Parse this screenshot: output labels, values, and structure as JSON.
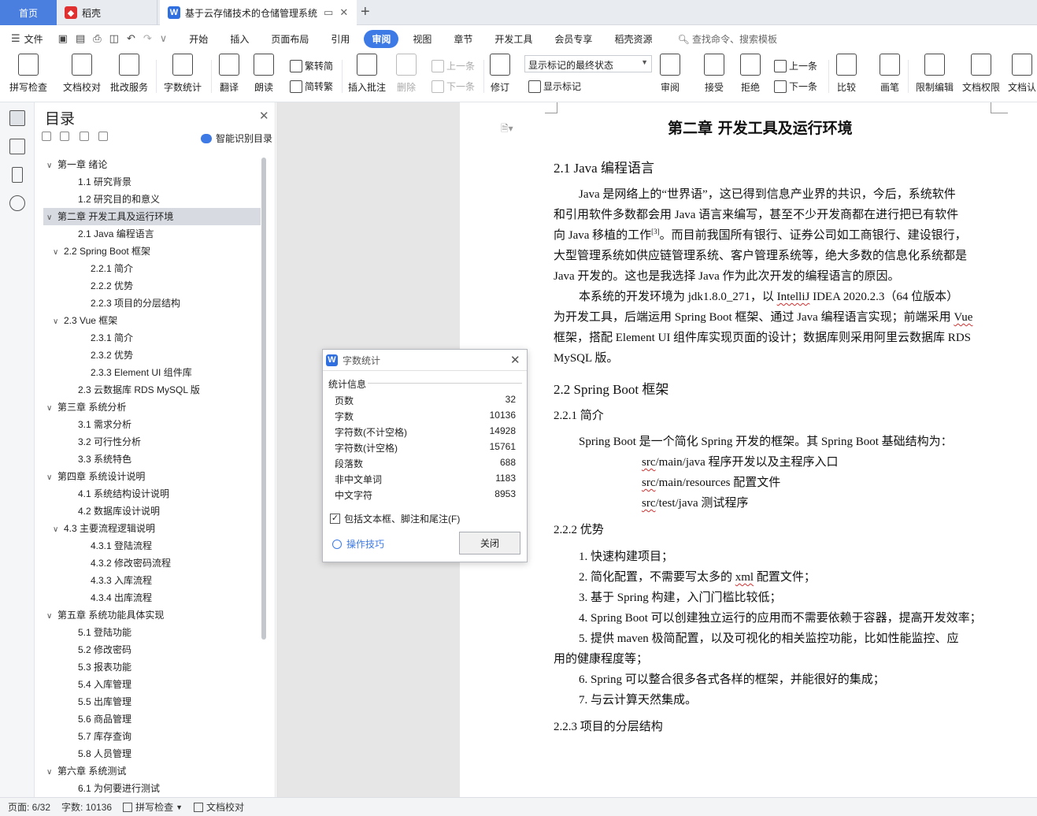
{
  "titlebar": {
    "home_tab": "首页",
    "daoke_tab": "稻壳",
    "doc_tab": "基于云存储技术的仓储管理系统",
    "new_tab": "+"
  },
  "menu": {
    "file": "文件",
    "items": [
      "开始",
      "插入",
      "页面布局",
      "引用",
      "审阅",
      "视图",
      "章节",
      "开发工具",
      "会员专享",
      "稻壳资源"
    ],
    "active": "审阅",
    "search": "查找命令、搜索模板"
  },
  "ribbon": {
    "spell_check": "拼写检查",
    "doc_proof": "文档校对",
    "batch_service": "批改服务",
    "word_count": "字数统计",
    "translate": "翻译",
    "read_aloud": "朗读",
    "trad_to_simp": "繁转简",
    "simp_to_trad": "简转繁",
    "insert_comment": "插入批注",
    "delete": "删除",
    "prev_comment": "上一条",
    "next_comment": "下一条",
    "track_changes": "修订",
    "markup_select": "显示标记的最终状态",
    "show_markup": "显示标记",
    "review_pane": "审阅",
    "accept": "接受",
    "reject": "拒绝",
    "prev_change": "上一条",
    "next_change": "下一条",
    "compare": "比较",
    "ink": "画笔",
    "restrict_edit": "限制编辑",
    "doc_permission": "文档权限",
    "doc_cert": "文档认"
  },
  "toc": {
    "title": "目录",
    "smart": "智能识别目录",
    "items": [
      {
        "label": "第一章  绪论",
        "level": 1,
        "arrow": "∨",
        "sel": false
      },
      {
        "label": "1.1 研究背景",
        "level": 2,
        "arrow": "",
        "sel": false
      },
      {
        "label": "1.2 研究目的和意义",
        "level": 2,
        "arrow": "",
        "sel": false
      },
      {
        "label": "第二章  开发工具及运行环境",
        "level": 1,
        "arrow": "∨",
        "sel": true
      },
      {
        "label": "2.1 Java 编程语言",
        "level": 2,
        "arrow": "",
        "sel": false
      },
      {
        "label": "2.2 Spring Boot 框架",
        "level": 2,
        "arrow": "∨",
        "sel": false
      },
      {
        "label": "2.2.1  简介",
        "level": 3,
        "arrow": "",
        "sel": false
      },
      {
        "label": "2.2.2  优势",
        "level": 3,
        "arrow": "",
        "sel": false
      },
      {
        "label": "2.2.3  项目的分层结构",
        "level": 3,
        "arrow": "",
        "sel": false
      },
      {
        "label": "2.3 Vue 框架",
        "level": 2,
        "arrow": "∨",
        "sel": false
      },
      {
        "label": "2.3.1  简介",
        "level": 3,
        "arrow": "",
        "sel": false
      },
      {
        "label": "2.3.2  优势",
        "level": 3,
        "arrow": "",
        "sel": false
      },
      {
        "label": "2.3.3 Element UI 组件库",
        "level": 3,
        "arrow": "",
        "sel": false
      },
      {
        "label": "2.3  云数据库 RDS MySQL 版",
        "level": 2,
        "arrow": "",
        "sel": false
      },
      {
        "label": "第三章  系统分析",
        "level": 1,
        "arrow": "∨",
        "sel": false
      },
      {
        "label": "3.1  需求分析",
        "level": 2,
        "arrow": "",
        "sel": false
      },
      {
        "label": "3.2  可行性分析",
        "level": 2,
        "arrow": "",
        "sel": false
      },
      {
        "label": "3.3  系统特色",
        "level": 2,
        "arrow": "",
        "sel": false
      },
      {
        "label": "第四章  系统设计说明",
        "level": 1,
        "arrow": "∨",
        "sel": false
      },
      {
        "label": "4.1  系统结构设计说明",
        "level": 2,
        "arrow": "",
        "sel": false
      },
      {
        "label": "4.2  数据库设计说明",
        "level": 2,
        "arrow": "",
        "sel": false
      },
      {
        "label": "4.3  主要流程逻辑说明",
        "level": 2,
        "arrow": "∨",
        "sel": false
      },
      {
        "label": "4.3.1  登陆流程",
        "level": 3,
        "arrow": "",
        "sel": false
      },
      {
        "label": "4.3.2  修改密码流程",
        "level": 3,
        "arrow": "",
        "sel": false
      },
      {
        "label": "4.3.3  入库流程",
        "level": 3,
        "arrow": "",
        "sel": false
      },
      {
        "label": "4.3.4  出库流程",
        "level": 3,
        "arrow": "",
        "sel": false
      },
      {
        "label": "第五章  系统功能具体实现",
        "level": 1,
        "arrow": "∨",
        "sel": false
      },
      {
        "label": "5.1  登陆功能",
        "level": 2,
        "arrow": "",
        "sel": false
      },
      {
        "label": "5.2  修改密码",
        "level": 2,
        "arrow": "",
        "sel": false
      },
      {
        "label": "5.3  报表功能",
        "level": 2,
        "arrow": "",
        "sel": false
      },
      {
        "label": "5.4  入库管理",
        "level": 2,
        "arrow": "",
        "sel": false
      },
      {
        "label": "5.5  出库管理",
        "level": 2,
        "arrow": "",
        "sel": false
      },
      {
        "label": "5.6  商品管理",
        "level": 2,
        "arrow": "",
        "sel": false
      },
      {
        "label": "5.7  库存查询",
        "level": 2,
        "arrow": "",
        "sel": false
      },
      {
        "label": "5.8  人员管理",
        "level": 2,
        "arrow": "",
        "sel": false
      },
      {
        "label": "第六章  系统测试",
        "level": 1,
        "arrow": "∨",
        "sel": false
      },
      {
        "label": "6.1  为何要进行测试",
        "level": 2,
        "arrow": "",
        "sel": false
      }
    ]
  },
  "document": {
    "chapter_title": "第二章  开发工具及运行环境",
    "h_21": "2.1 Java 编程语言",
    "p1_l1": "Java 是网络上的“世界语”，这已得到信息产业界的共识，今后，系统软件",
    "p1_l2": "和引用软件多数都会用 Java 语言来编写，甚至不少开发商都在进行把已有软件",
    "p1_l3a": "向 Java 移植的工作",
    "p1_l3_ref": "[3]",
    "p1_l3b": "。而目前我国所有银行、证券公司如工商银行、建设银行，",
    "p1_l4": "大型管理系统如供应链管理系统、客户管理系统等，绝大多数的信息化系统都是",
    "p1_l5": "Java 开发的。这也是我选择 Java 作为此次开发的编程语言的原因。",
    "p2_l1a": "本系统的开发环境为 jdk1.8.0_271，以 ",
    "p2_l1_w": "IntelliJ",
    "p2_l1b": " IDEA 2020.2.3（64 位版本）",
    "p2_l2a": "为开发工具，后端运用 Spring Boot 框架、通过 Java 编程语言实现；前端采用 ",
    "p2_l2_w": "Vue",
    "p2_l3": "框架，搭配 Element UI 组件库实现页面的设计；数据库则采用阿里云数据库 RDS",
    "p2_l4": "MySQL 版。",
    "h_22": "2.2 Spring Boot 框架",
    "h_221": "2.2.1  简介",
    "p3": "Spring Boot 是一个简化 Spring 开发的框架。其 Spring Boot 基础结构为：",
    "path1_w": "src",
    "path1": "/main/java  程序开发以及主程序入口",
    "path2_w": "src",
    "path2": "/main/resources  配置文件",
    "path3_w": "src",
    "path3": "/test/java  测试程序",
    "h_222": "2.2.2  优势",
    "li1": "1.  快速构建项目；",
    "li2a": "2.  简化配置，不需要写太多的 ",
    "li2_w": "xml",
    "li2b": " 配置文件；",
    "li3": "3.  基于 Spring 构建，入门门槛比较低；",
    "li4": "4. Spring Boot 可以创建独立运行的应用而不需要依赖于容器，提高开发效率；",
    "li5_l1": "5.  提供 maven  极简配置，以及可视化的相关监控功能，比如性能监控、应",
    "li5_l2": "用的健康程度等；",
    "li6": "6. Spring  可以整合很多各式各样的框架，并能很好的集成；",
    "li7": "7.  与云计算天然集成。",
    "h_223": "2.2.3  项目的分层结构"
  },
  "dialog": {
    "title": "字数统计",
    "group": "统计信息",
    "rows": [
      {
        "label": "页数",
        "value": "32"
      },
      {
        "label": "字数",
        "value": "10136"
      },
      {
        "label": "字符数(不计空格)",
        "value": "14928"
      },
      {
        "label": "字符数(计空格)",
        "value": "15761"
      },
      {
        "label": "段落数",
        "value": "688"
      },
      {
        "label": "非中文单词",
        "value": "1183"
      },
      {
        "label": "中文字符",
        "value": "8953"
      }
    ],
    "checkbox": "包括文本框、脚注和尾注(F)",
    "checked_mark": "✓",
    "tips": "操作技巧",
    "close": "关闭"
  },
  "status": {
    "page": "页面: 6/32",
    "words": "字数: 10136",
    "spell": "拼写检查",
    "proof": "文档校对"
  }
}
